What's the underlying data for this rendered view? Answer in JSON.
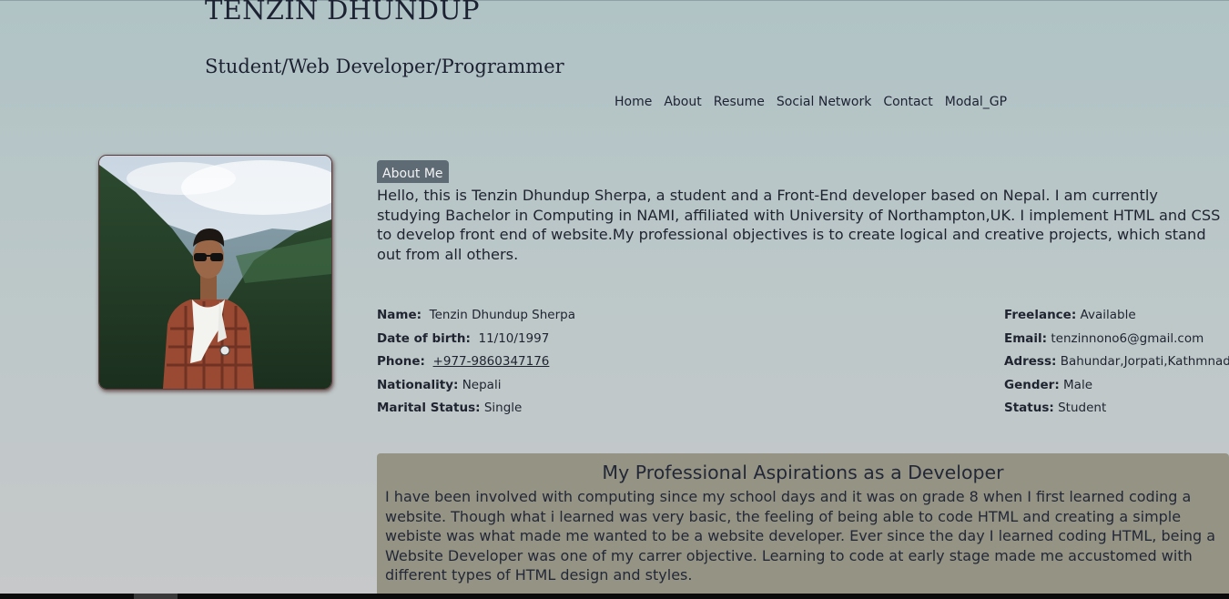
{
  "header": {
    "site_name": "TENZIN DHUNDUP",
    "subtitle": "Student/Web Developer/Programmer"
  },
  "nav": {
    "items": [
      "Home",
      "About",
      "Resume",
      "Social Network",
      "Contact",
      "Modal_GP"
    ]
  },
  "about": {
    "tab_label": "About Me",
    "text": "Hello, this is Tenzin Dhundup Sherpa, a student and a Front-End developer based on Nepal. I am currently studying Bachelor in Computing in NAMI, affiliated with University of Northampton,UK. I implement HTML and CSS to develop front end of website.My professional objectives is to create logical and creative projects, which stand out from all others."
  },
  "details_left": [
    {
      "label": "Name:",
      "value": "Tenzin Dhundup Sherpa"
    },
    {
      "label": "Date of birth:",
      "value": "11/10/1997"
    },
    {
      "label": "Phone:",
      "value": "+977-9860347176"
    },
    {
      "label": "Nationality:",
      "value": "Nepali"
    },
    {
      "label": "Marital Status:",
      "value": "Single"
    }
  ],
  "details_right": [
    {
      "label": "Freelance:",
      "value": "Available"
    },
    {
      "label": "Email:",
      "value": "tenzinnono6@gmail.com"
    },
    {
      "label": "Adress:",
      "value": "Bahundar,Jorpati,Kathmnadu"
    },
    {
      "label": "Gender:",
      "value": "Male"
    },
    {
      "label": "Status:",
      "value": "Student"
    }
  ],
  "aspirations": {
    "title": "My Professional Aspirations as a Developer",
    "text": "I have been involved with computing since my school days and it was on grade 8 when I first learned coding a website. Though what i learned was very basic, the feeling of being able to code HTML and creating a simple webiste was what made me wanted to be a website developer. Ever since the day I learned coding HTML, being a Website Developer was one of my carrer objective. Learning to code at early stage made me accustomed with different types of HTML design and styles."
  },
  "colors": {
    "background_top": "#b0c3c5",
    "background_bottom": "#c6c8c9",
    "tab_background": "#5f6b74",
    "aspiration_background": "#959484",
    "text": "#1f2430"
  },
  "icons": {
    "profile_photo": "profile-photo"
  }
}
